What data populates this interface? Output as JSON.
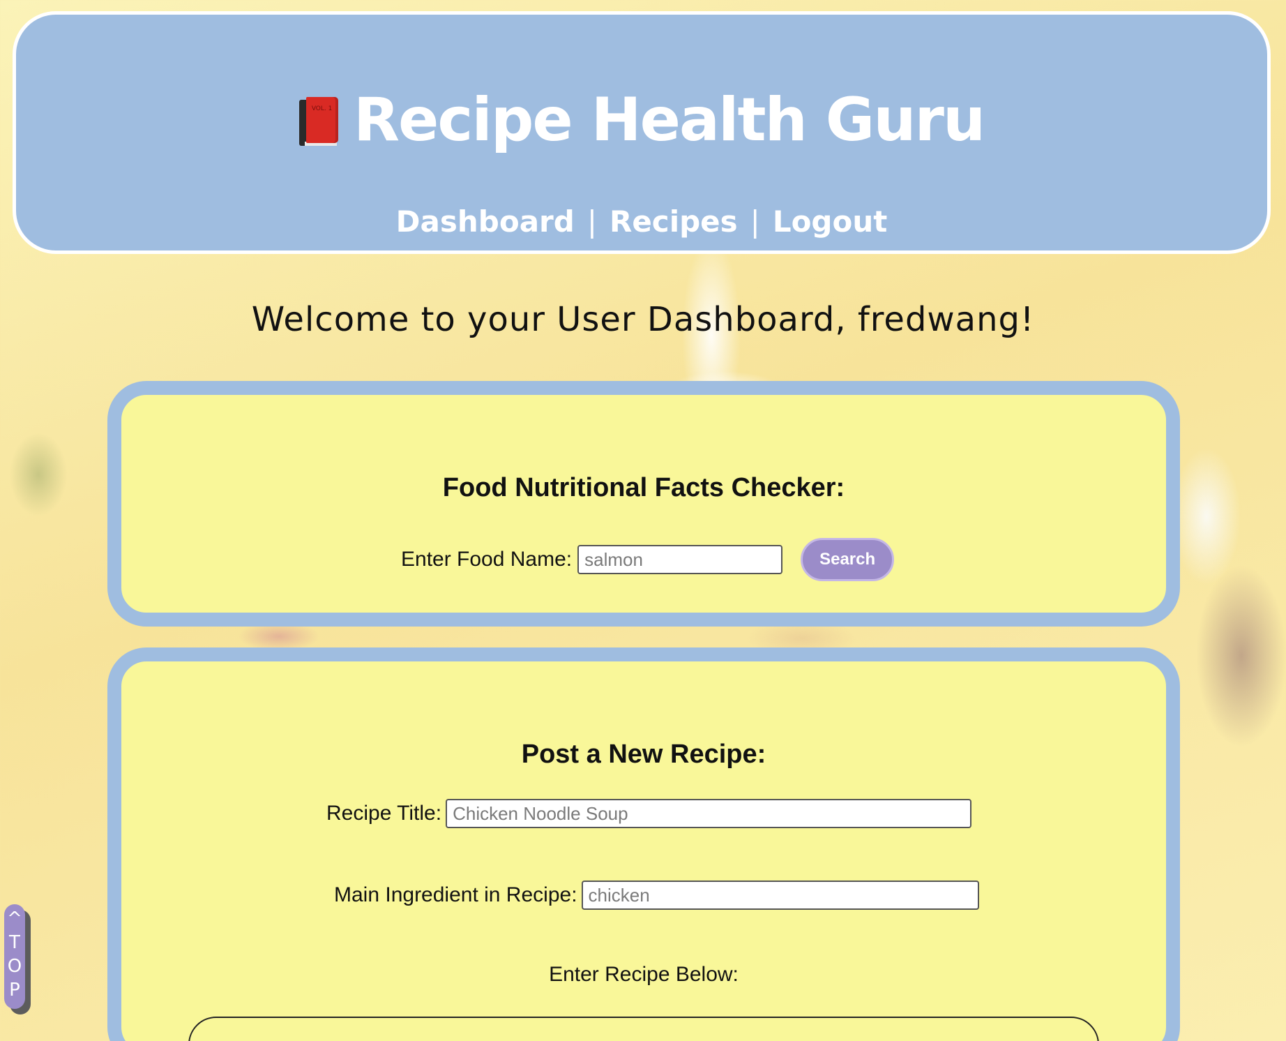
{
  "header": {
    "app_title": "Recipe Health Guru",
    "book_icon_label": "VOL. 1",
    "nav": {
      "dashboard": "Dashboard",
      "recipes": "Recipes",
      "logout": "Logout",
      "separator": "|"
    }
  },
  "welcome_text": "Welcome to your User Dashboard, fredwang!",
  "food_checker": {
    "heading": "Food Nutritional Facts Checker:",
    "label": "Enter Food Name:",
    "placeholder": "salmon",
    "search_label": "Search"
  },
  "recipe_form": {
    "heading": "Post a New Recipe:",
    "title_label": "Recipe Title:",
    "title_placeholder": "Chicken Noodle Soup",
    "ingredient_label": "Main Ingredient in Recipe:",
    "ingredient_placeholder": "chicken",
    "recipe_label": "Enter Recipe Below:"
  },
  "top_button": {
    "label": "^\nT\nO\nP"
  },
  "colors": {
    "header_bg": "#9fbde0",
    "panel_bg": "#f9f799",
    "button_bg": "#9b8cc9"
  }
}
